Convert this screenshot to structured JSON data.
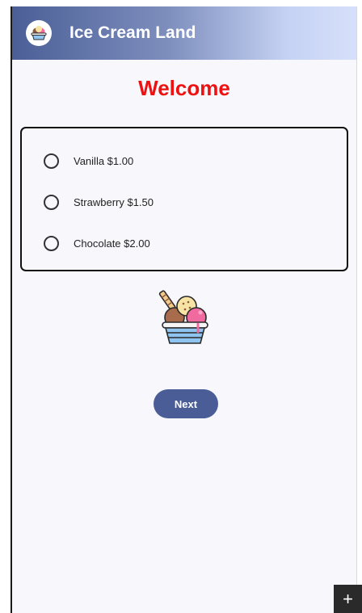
{
  "app_bar": {
    "title": "Ice Cream Land",
    "logo_icon": "ice-cream-sundae-icon",
    "gradient": [
      "#4b5f97",
      "#d6e0fb"
    ]
  },
  "main": {
    "heading": "Welcome",
    "heading_color": "#ee1111",
    "options": [
      {
        "label": "Vanilla $1.00",
        "selected": false
      },
      {
        "label": "Strawberry $1.50",
        "selected": false
      },
      {
        "label": "Chocolate $2.00",
        "selected": false
      }
    ],
    "illustration_icon": "ice-cream-sundae-icon",
    "next_label": "Next",
    "accent": "#4a5d96"
  },
  "corner_button": {
    "icon": "plus-icon",
    "label": "+"
  }
}
